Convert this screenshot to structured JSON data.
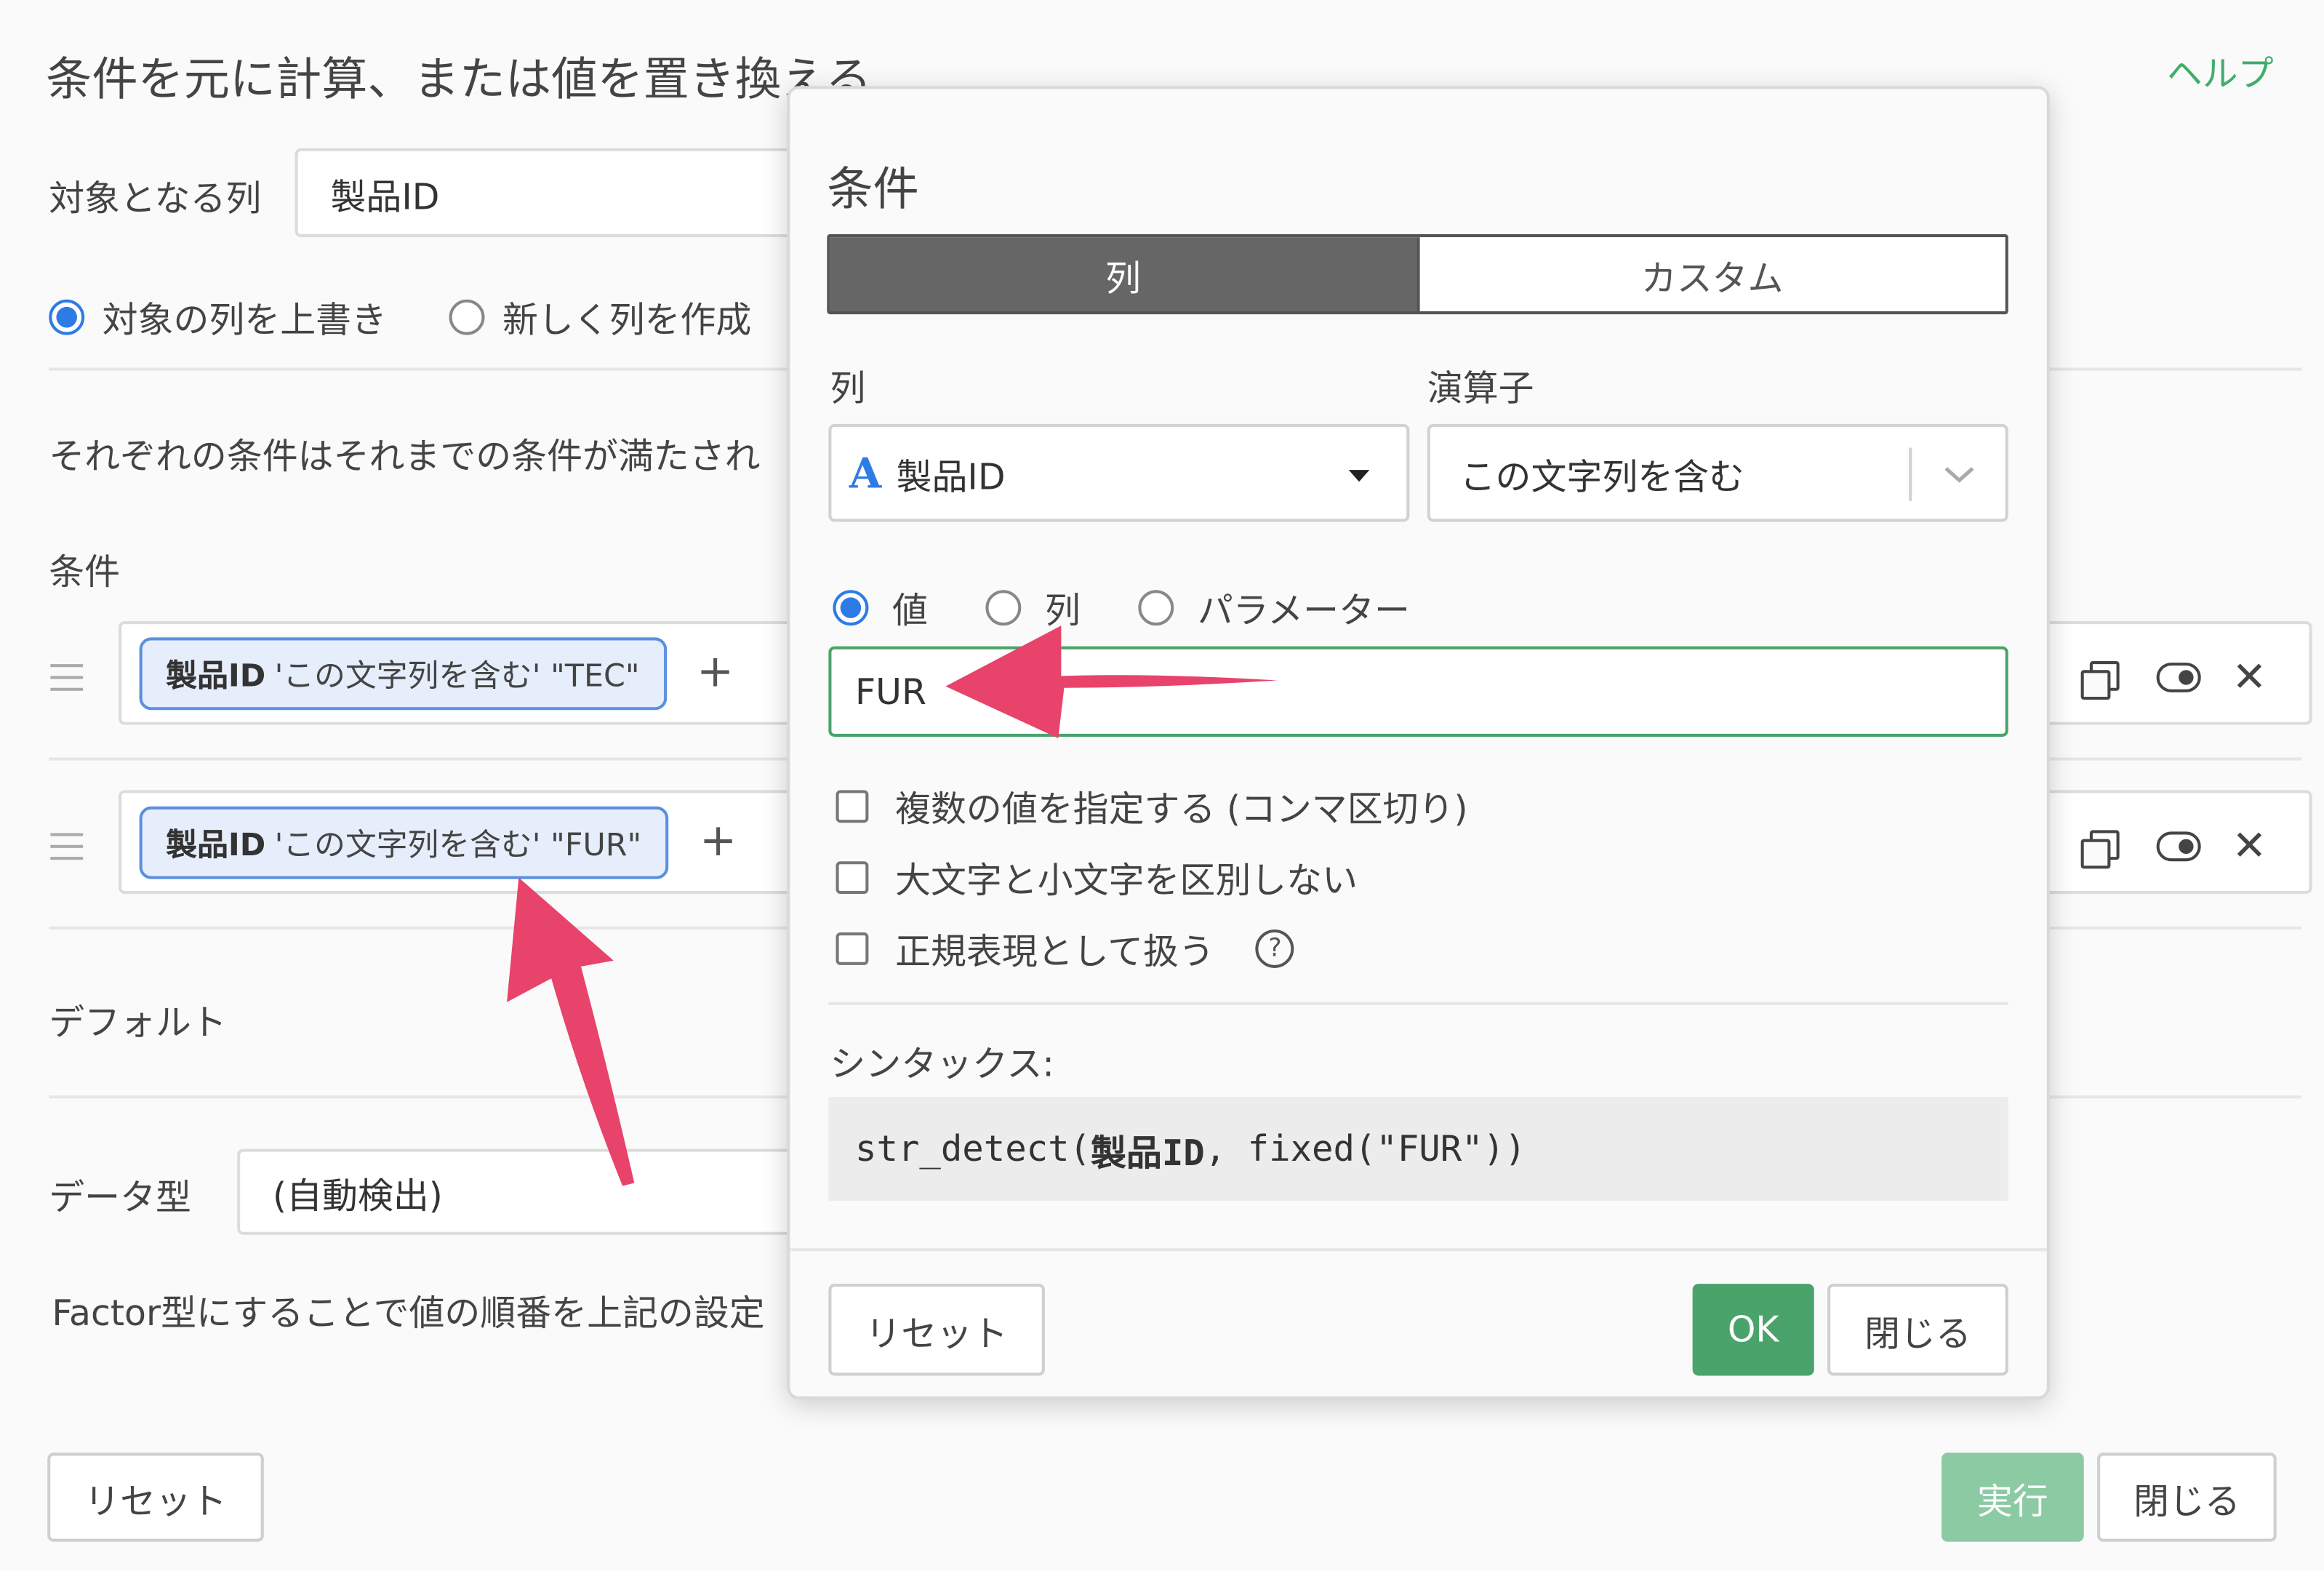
{
  "main": {
    "title": "条件を元に計算、または値を置き換える",
    "help": "ヘルプ",
    "target_label": "対象となる列",
    "target_value": "製品ID",
    "radio_overwrite": "対象の列を上書き",
    "radio_new": "新しく列を作成",
    "description": "それぞれの条件はそれまでの条件が満たされ",
    "conditions_label": "条件",
    "conditions": [
      {
        "column": "製品ID",
        "rest": "'この文字列を含む' \"TEC\""
      },
      {
        "column": "製品ID",
        "rest": "'この文字列を含む' \"FUR\""
      }
    ],
    "add": "+",
    "default_label": "デフォルト",
    "datatype_label": "データ型",
    "datatype_value": "(自動検出)",
    "factor_note": "Factor型にすることで値の順番を上記の設定",
    "reset": "リセット",
    "run": "実行",
    "close": "閉じる"
  },
  "dialog": {
    "title": "条件",
    "tab_column": "列",
    "tab_custom": "カスタム",
    "col_label": "列",
    "op_label": "演算子",
    "col_value": "製品ID",
    "col_type_glyph": "A",
    "op_value": "この文字列を含む",
    "radio_value": "値",
    "radio_column": "列",
    "radio_param": "パラメーター",
    "value": "FUR",
    "check_multi": "複数の値を指定する (コンマ区切り)",
    "check_case": "大文字と小文字を区別しない",
    "check_regex": "正規表現として扱う",
    "help_glyph": "?",
    "syntax_label": "シンタックス:",
    "syntax_prefix": "str_detect(",
    "syntax_col": "製品ID",
    "syntax_suffix": ", fixed(\"FUR\"))",
    "reset": "リセット",
    "ok": "OK",
    "close": "閉じる"
  },
  "colors": {
    "accent_green": "#4aa36b",
    "radio_blue": "#2d7be5",
    "arrow_pink": "#e8436b"
  }
}
